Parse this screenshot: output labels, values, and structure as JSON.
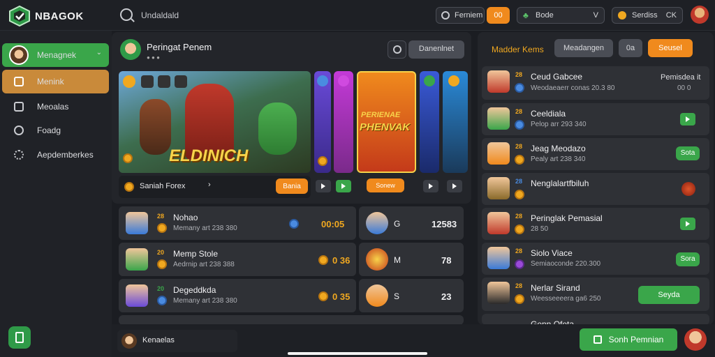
{
  "topbar": {
    "logo_text": "NBAGOK",
    "search_text": "Undaldald",
    "pill1_label": "Ferniem",
    "pill2_label": "00",
    "pill3_label": "Bode",
    "pill3_caret": "V",
    "pill4_label": "Serdiss",
    "pill4_suffix": "CK"
  },
  "sidebar": {
    "items": [
      {
        "label": "Menagnek"
      },
      {
        "label": "Menink"
      },
      {
        "label": "Meoalas"
      },
      {
        "label": "Foadg"
      },
      {
        "label": "Aepdemberkes"
      }
    ]
  },
  "featured": {
    "title": "Peringat Penem",
    "button": "Danenlnet",
    "banner_title": "ELDINICH",
    "banner2_title_top": "PERIENAE",
    "banner2_title": "PHENVAK",
    "caption": "Saniah Forex",
    "caption_btn": "Bania",
    "banner2_btn": "Sonew"
  },
  "list": {
    "rows": [
      {
        "badge": "28",
        "name": "Nohao",
        "sub": "Memany art 238 380",
        "time": "00:05",
        "mid": "G",
        "value": "12583"
      },
      {
        "badge": "20",
        "name": "Memp Stole",
        "sub": "Aedrnip art 238 388",
        "time": "0 36",
        "mid": "M",
        "value": "78"
      },
      {
        "badge": "20",
        "name": "Degeddkda",
        "sub": "Memany art 238 380",
        "time": "0 35",
        "mid": "S",
        "value": "23"
      }
    ]
  },
  "right": {
    "header_title": "Madder Kems",
    "tab1": "Meadangen",
    "tab2": "0a",
    "tab3": "Seusel",
    "items": [
      {
        "badge": "28",
        "name": "Ceud Gabcee",
        "sub": "Weodaeaerr conas 20.3 80",
        "right_top": "Pemisdea it",
        "right_bot": "00 0"
      },
      {
        "badge": "28",
        "name": "Ceeldiala",
        "sub": "Pelop arr 293 340"
      },
      {
        "badge": "28",
        "name": "Jeag Meodazo",
        "sub": "Pealy art 238 340",
        "btn": "Sota"
      },
      {
        "badge": "28",
        "name": "Nenglalartfbiluh"
      },
      {
        "badge": "28",
        "name": "Peringlak Pemasial",
        "sub": "28 50"
      },
      {
        "badge": "28",
        "name": "Siolo Viace",
        "sub": "Semiaoconde 220.300",
        "btn": "Sora"
      },
      {
        "badge": "28",
        "name": "Nerlar Sirand",
        "sub": "Weesseeeera ga6 250",
        "btn": "Seyda"
      },
      {
        "badge": "28",
        "name": "Genn Ofeta"
      }
    ]
  },
  "bottom": {
    "user": "Kenaelas",
    "cta": "Sonh Pemnian"
  }
}
